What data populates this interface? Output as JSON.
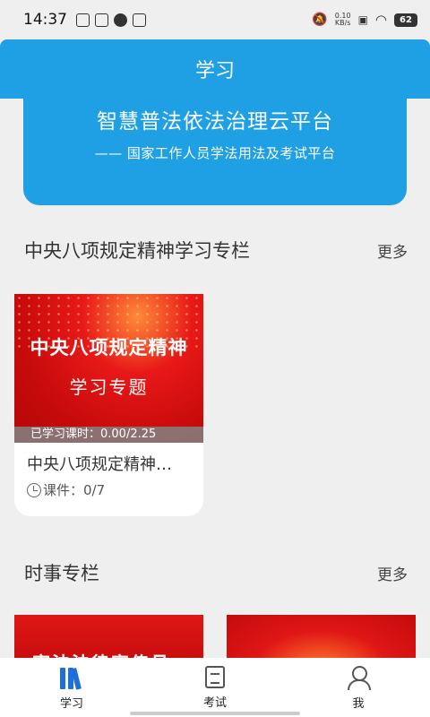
{
  "status_bar": {
    "time": "14:37",
    "net_speed_value": "0.10",
    "net_speed_unit": "KB/s",
    "battery": "62"
  },
  "header": {
    "title": "学习"
  },
  "banner": {
    "title": "智慧普法依法治理云平台",
    "subtitle": "—— 国家工作人员学法用法及考试平台"
  },
  "sections": [
    {
      "title": "中央八项规定精神学习专栏",
      "more_label": "更多",
      "courses": [
        {
          "cover_title": "中央八项规定精神",
          "cover_subtitle": "学习专题",
          "study_time": "已学习课时：0.00/2.25",
          "name": "中央八项规定精神…",
          "lessons": "课件：0/7"
        }
      ]
    },
    {
      "title": "时事专栏",
      "more_label": "更多",
      "peek_text": "宪法法律宣传月"
    }
  ],
  "tabbar": {
    "items": [
      {
        "label": "学习",
        "icon": "books-icon",
        "active": true
      },
      {
        "label": "考试",
        "icon": "exam-paper-icon",
        "active": false
      },
      {
        "label": "我",
        "icon": "person-icon",
        "active": false
      }
    ]
  },
  "colors": {
    "accent": "#1fa0e5",
    "active_tab": "#1e6fd9",
    "background": "#efefef"
  }
}
